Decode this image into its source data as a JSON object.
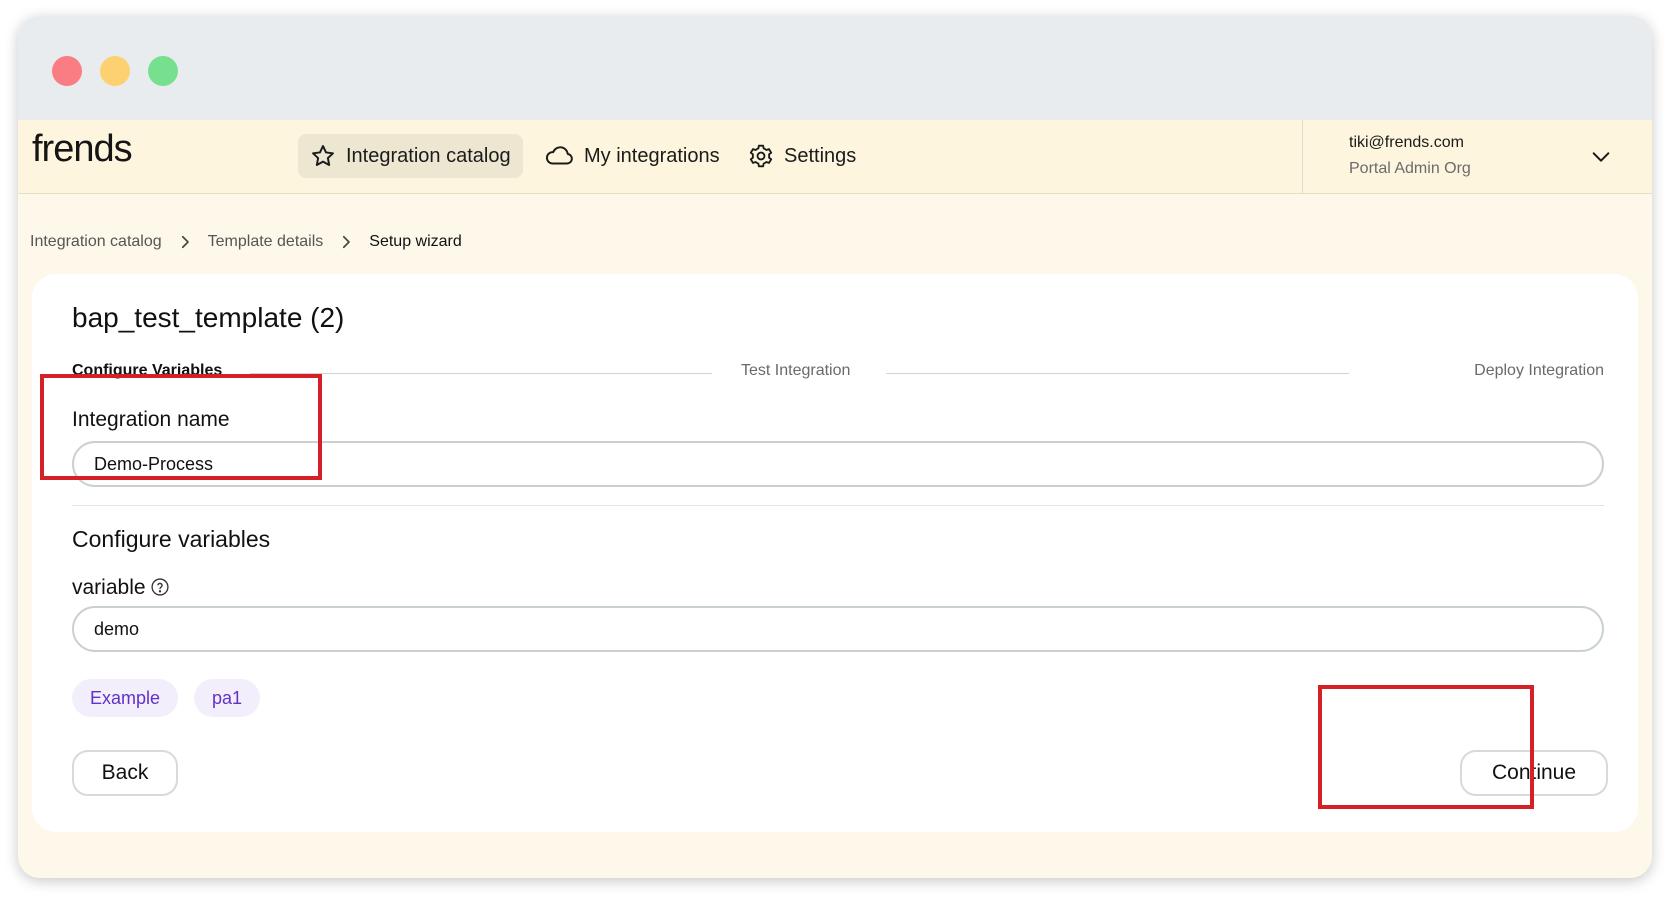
{
  "app": {
    "logo": "frends"
  },
  "nav": {
    "items": [
      {
        "label": "Integration catalog",
        "icon": "star-icon",
        "active": true
      },
      {
        "label": "My integrations",
        "icon": "cloud-icon",
        "active": false
      },
      {
        "label": "Settings",
        "icon": "gear-icon",
        "active": false
      }
    ]
  },
  "account": {
    "email": "tiki@frends.com",
    "org": "Portal Admin Org"
  },
  "breadcrumb": [
    "Integration catalog",
    "Template details",
    "Setup wizard"
  ],
  "page": {
    "title": "bap_test_template (2)"
  },
  "steps": [
    "Configure Variables",
    "Test Integration",
    "Deploy Integration"
  ],
  "form": {
    "integration_name_label": "Integration name",
    "integration_name_value": "Demo-Process",
    "section_title": "Configure variables",
    "variable_label": "variable",
    "variable_value": "demo",
    "chips": [
      "Example",
      "pa1"
    ]
  },
  "buttons": {
    "back": "Back",
    "continue": "Continue"
  },
  "colors": {
    "accent": "#6231c9",
    "highlight": "#d62027",
    "background": "#fdf8ea"
  }
}
